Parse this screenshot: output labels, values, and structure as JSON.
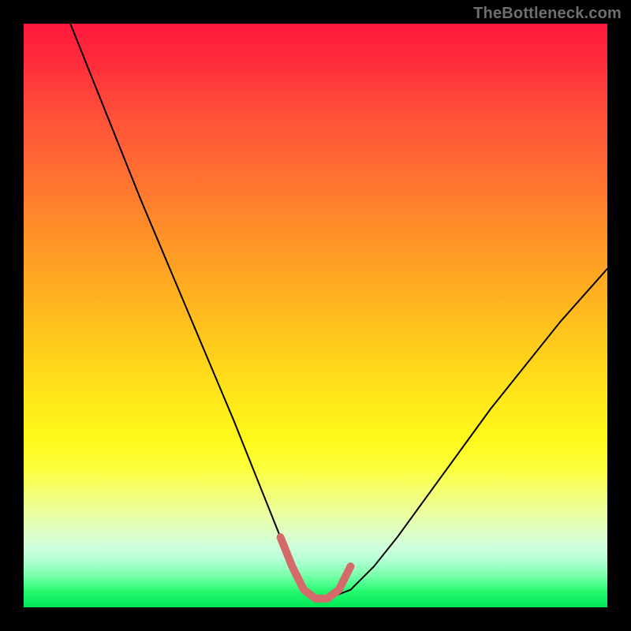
{
  "meta": {
    "watermark": "TheBottleneck.com"
  },
  "chart_data": {
    "type": "line",
    "title": "",
    "xlabel": "",
    "ylabel": "",
    "xlim": [
      0,
      100
    ],
    "ylim": [
      0,
      100
    ],
    "grid": false,
    "legend": false,
    "series": [
      {
        "name": "bottleneck-curve",
        "stroke": "#000000",
        "stroke_width": 2,
        "x": [
          8,
          12,
          16,
          20,
          24,
          28,
          32,
          36,
          40,
          42,
          44,
          46,
          48,
          50,
          52,
          56,
          60,
          64,
          68,
          72,
          76,
          80,
          84,
          88,
          92,
          96,
          100
        ],
        "y": [
          100,
          90,
          80,
          70,
          60.5,
          51,
          41.5,
          32,
          22,
          17,
          12,
          7,
          3,
          1.5,
          1.5,
          3,
          7,
          12,
          17.5,
          23,
          28.5,
          34,
          39,
          44,
          49,
          53.5,
          58
        ]
      },
      {
        "name": "optimal-zone-highlight",
        "stroke": "#d46a6a",
        "stroke_width": 10,
        "x": [
          44,
          46,
          48,
          50,
          52,
          54,
          56
        ],
        "y": [
          12,
          7,
          3,
          1.5,
          1.5,
          3,
          7
        ]
      }
    ],
    "background_gradient": {
      "direction": "vertical",
      "stops": [
        {
          "pos": 0,
          "color": "#ff1a3c"
        },
        {
          "pos": 34,
          "color": "#ff8a2a"
        },
        {
          "pos": 63,
          "color": "#ffe419"
        },
        {
          "pos": 80,
          "color": "#f4ff70"
        },
        {
          "pos": 93,
          "color": "#9cffc4"
        },
        {
          "pos": 100,
          "color": "#00e756"
        }
      ]
    }
  }
}
